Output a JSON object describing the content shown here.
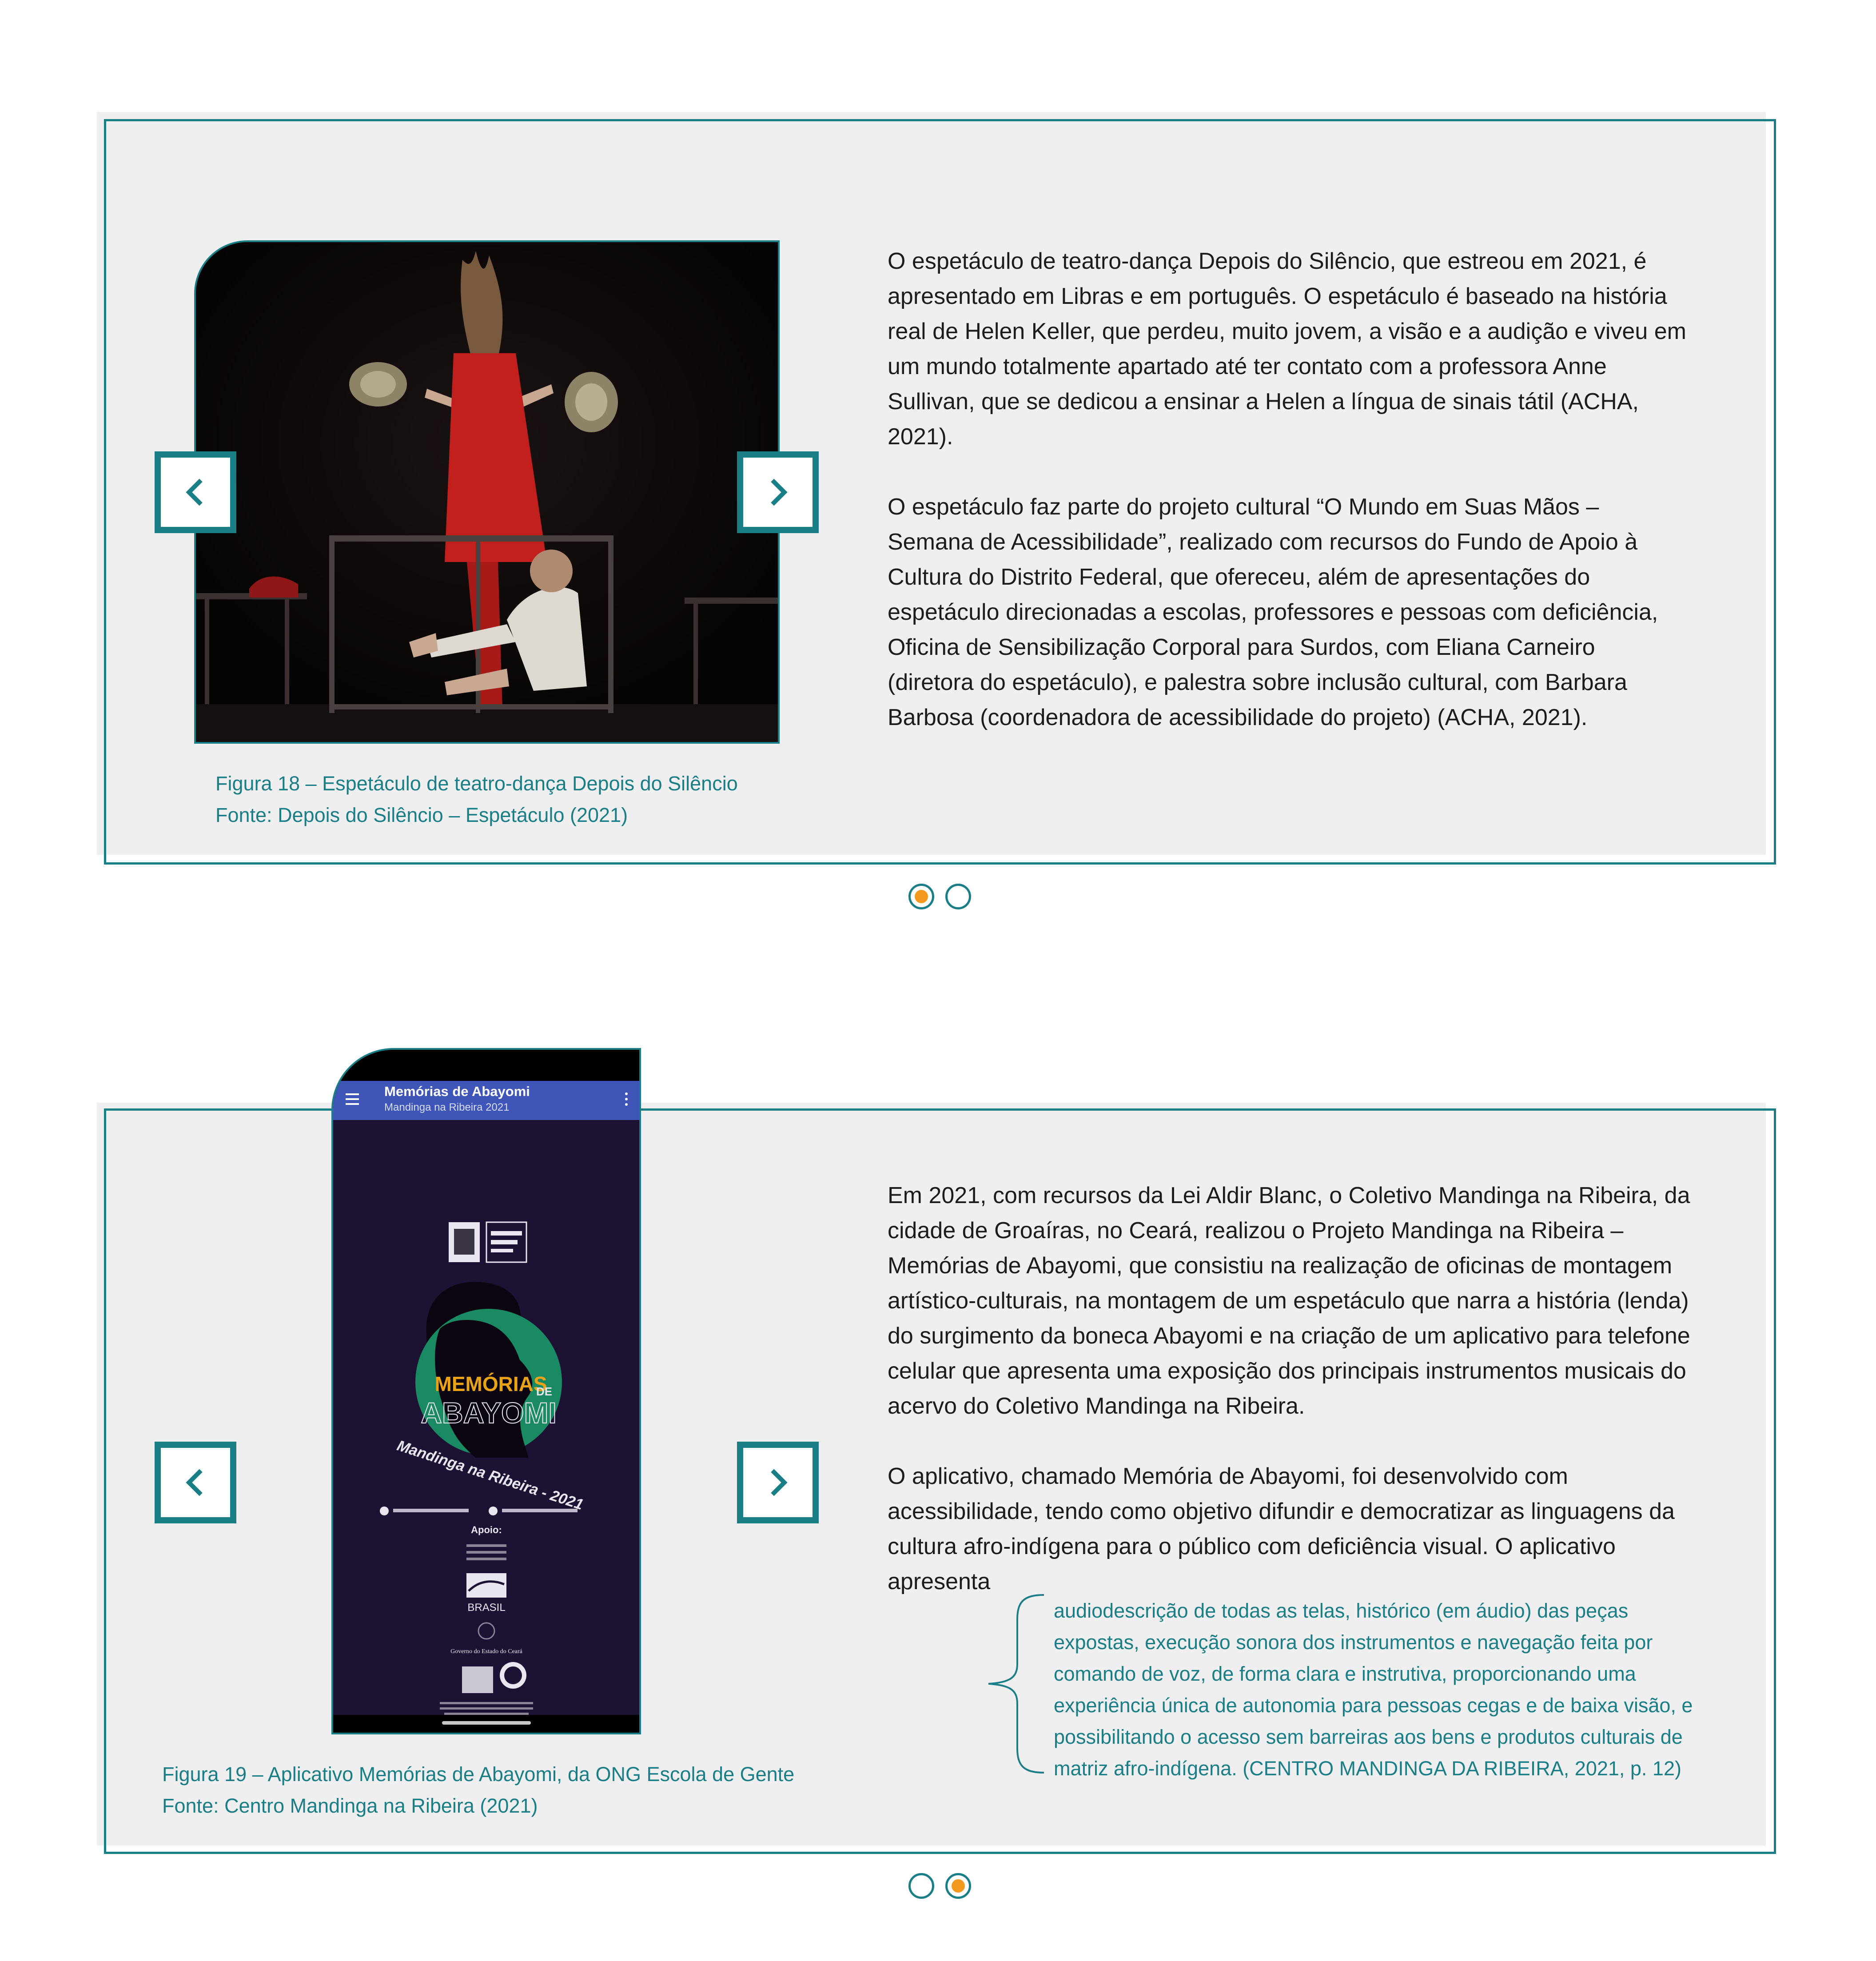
{
  "slide1": {
    "prev_label": "Anterior",
    "next_label": "Próximo",
    "paragraph1": "O espetáculo de teatro-dança Depois do Silêncio, que estreou em 2021, é apresentado em Libras e em português. O espetáculo é baseado na história real de Helen Keller, que perdeu, muito jovem, a visão e a audição e viveu em um mundo totalmente apartado até ter contato com a professora Anne Sullivan, que se dedicou a ensinar a Helen a língua de sinais tátil (ACHA, 2021).",
    "paragraph2": "O espetáculo faz parte do projeto cultural “O Mundo em Suas Mãos – Semana de Acessibilidade”, realizado com recursos do Fundo de Apoio à Cultura do Distrito Federal, que ofereceu, além de apresentações do espetáculo direcionadas a escolas, professores e pessoas com deficiência, Oficina de Sensibilização Corporal para Surdos, com Eliana Carneiro (diretora do espetáculo), e palestra sobre inclusão cultural, com Barbara Barbosa (coordenadora de acessibilidade do projeto) (ACHA, 2021).",
    "caption_figure": "Figura 18 – Espetáculo de teatro-dança Depois do Silêncio",
    "caption_source": "Fonte: Depois do Silêncio – Espetáculo (2021)",
    "pagination": [
      {
        "active": true
      },
      {
        "active": false
      }
    ]
  },
  "slide2": {
    "prev_label": "Anterior",
    "next_label": "Próximo",
    "phone": {
      "app_title": "Memórias de Abayomi",
      "app_subtitle": "Mandinga na Ribeira 2021",
      "poster_title_1": "MEMÓRIAS",
      "poster_title_de": "DE",
      "poster_title_2": "ABAYOMI",
      "poster_arc": "Mandinga na Ribeira - 2021",
      "poster_support": "Apoio:",
      "poster_brasil": "BRASIL",
      "poster_ceara": "Governo do Estado do Ceará"
    },
    "paragraph1": "Em 2021, com recursos da Lei Aldir Blanc, o Coletivo Mandinga na Ribeira, da cidade de Groaíras, no Ceará, realizou o Projeto Mandinga na Ribeira – Memórias de Abayomi, que consistiu na realização de oficinas de montagem artístico-culturais, na montagem de um espetáculo que narra a história (lenda) do surgimento da boneca Abayomi e na criação de um aplicativo para telefone celular que apresenta uma exposição dos principais instrumentos musicais do acervo do Coletivo Mandinga na Ribeira.",
    "paragraph2": "O aplicativo, chamado Memória de Abayomi, foi desenvolvido com acessibilidade, tendo como objetivo difundir e democratizar as linguagens da cultura afro-indígena para o público com deficiência visual. O aplicativo apresenta",
    "quote": "audiodescrição de todas as telas, histórico (em áudio) das peças expostas, execução sonora dos instrumentos e navegação feita por comando de voz, de forma clara e instrutiva, proporcionando uma experiência única de autonomia para pessoas cegas e de baixa visão, e possibilitando o acesso sem barreiras aos bens e produtos culturais de matriz afro-indígena. (CENTRO MANDINGA DA RIBEIRA, 2021, p. 12)",
    "caption_figure": "Figura 19 – Aplicativo Memórias de Abayomi, da ONG Escola de Gente",
    "caption_source": "Fonte: Centro Mandinga na Ribeira (2021)",
    "pagination": [
      {
        "active": false
      },
      {
        "active": true
      }
    ]
  },
  "colors": {
    "accent": "#1a7e86",
    "active_dot": "#f39a1e",
    "panel_bg": "#efefef",
    "text": "#1c1c1c",
    "app_bar": "#3f56b8",
    "poster_bg": "#1d1234",
    "poster_circle": "#1a8a63"
  },
  "icons": [
    "chevron-left-icon",
    "chevron-right-icon",
    "brace-icon"
  ]
}
